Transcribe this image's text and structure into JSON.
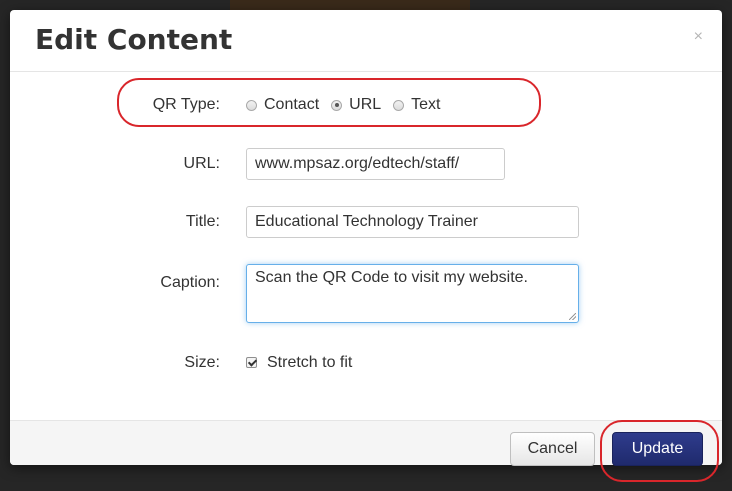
{
  "modal": {
    "title": "Edit Content",
    "close_glyph": "×"
  },
  "qr_type": {
    "label": "QR Type:",
    "options": [
      {
        "label": "Contact",
        "checked": false
      },
      {
        "label": "URL",
        "checked": true
      },
      {
        "label": "Text",
        "checked": false
      }
    ]
  },
  "url_field": {
    "label": "URL:",
    "value": "www.mpsaz.org/edtech/staff/"
  },
  "title_field": {
    "label": "Title:",
    "value": "Educational Technology Trainer"
  },
  "caption_field": {
    "label": "Caption:",
    "value": "Scan the QR Code to visit my website."
  },
  "size_field": {
    "label": "Size:",
    "checkbox_label": "Stretch to fit",
    "checked": true
  },
  "footer": {
    "cancel_label": "Cancel",
    "update_label": "Update"
  },
  "colors": {
    "annotation_red": "#d9262b",
    "primary_button": "#1f2a6d",
    "focus_border": "#66afe9"
  },
  "icons": {
    "close": "close-icon",
    "radio": "radio-button-icon",
    "checkbox": "checkbox-icon"
  }
}
